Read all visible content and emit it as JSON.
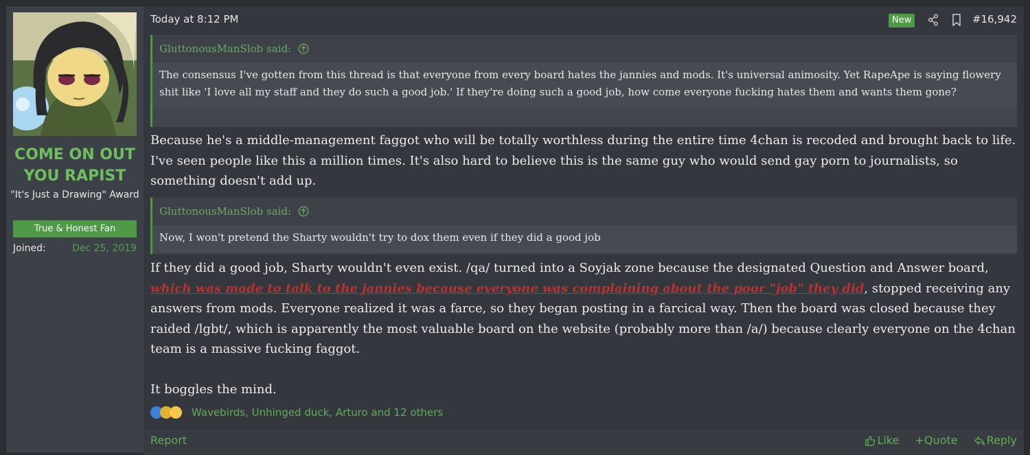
{
  "user": {
    "name": "COME ON OUT YOU RAPIST",
    "title": "\"It's Just a Drawing\" Award",
    "banner": "True & Honest Fan",
    "joined_label": "Joined:",
    "joined_value": "Dec 25, 2019"
  },
  "header": {
    "date": "Today at 8:12 PM",
    "badge": "New",
    "post_number": "#16,942"
  },
  "quotes": [
    {
      "author": "GluttonousManSlob said:",
      "text": "The consensus I've gotten from this thread is that everyone from every board hates the jannies and mods. It's universal animosity. Yet RapeApe is saying flowery shit like 'I love all my staff and they do such a good job.' If they're doing such a good job, how come everyone fucking hates them and wants them gone?"
    },
    {
      "author": "GluttonousManSlob said:",
      "text": "Now, I won't pretend the Sharty wouldn't try to dox them even if they did a good job"
    }
  ],
  "body": {
    "para1": "Because he's a middle-management faggot who will be totally worthless during the entire time 4chan is recoded and brought back to life. I've seen people like this a million times. It's also hard to believe this is the same guy who would send gay porn to journalists, so something doesn't add up.",
    "para2_start": "If they did a good job, Sharty wouldn't even exist. /qa/ turned into a Soyjak zone because the designated Question and Answer board, ",
    "para2_link": "which was made to talk to the jannies because everyone was complaining about the poor \"job\" they did",
    "para2_end": ", stopped receiving any answers from mods. Everyone realized it was a farce, so they began posting in a farcical way. Then the board was closed because they raided /lgbt/, which is apparently the most valuable board on the website (probably more than /a/) because clearly everyone on the 4chan team is a massive fucking faggot.",
    "para3": "It boggles the mind."
  },
  "reactions": {
    "icons": [
      "like-icon",
      "medal-icon",
      "thinking-icon"
    ],
    "users": "Wavebirds, Unhinged duck, Arturo and 12 others"
  },
  "footer": {
    "report": "Report",
    "like": "Like",
    "quote": "+Quote",
    "reply": "Reply"
  }
}
